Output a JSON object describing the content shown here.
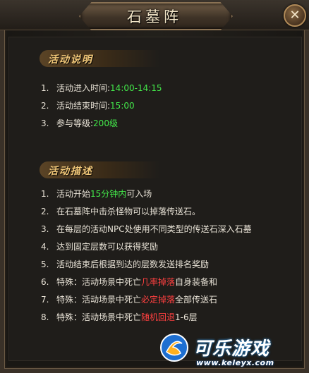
{
  "window": {
    "title": "石墓阵"
  },
  "sections": {
    "info": {
      "title": "活动说明",
      "items": [
        {
          "num": "1.",
          "label": "活动进入时间:",
          "value": "14:00-14:15"
        },
        {
          "num": "2.",
          "label": "活动结束时间:",
          "value": "15:00"
        },
        {
          "num": "3.",
          "label": "参与等级:",
          "value": "200级"
        }
      ]
    },
    "desc": {
      "title": "活动描述",
      "items": [
        {
          "num": "1.",
          "pre": "活动开始",
          "hl": "15分钟内",
          "post": "可入场"
        },
        {
          "num": "2.",
          "text": "在石墓阵中击杀怪物可以掉落传送石。"
        },
        {
          "num": "3.",
          "text": "在每层的活动NPC处使用不同类型的传送石深入石墓"
        },
        {
          "num": "4.",
          "text": "达到固定层数可以获得奖励"
        },
        {
          "num": "5.",
          "text": "活动结束后根据到达的层数发送排名奖励"
        },
        {
          "num": "6.",
          "pre": "特殊：活动场景中死亡",
          "hl": "几率掉落",
          "post": "自身装备和"
        },
        {
          "num": "7.",
          "pre": "特殊：活动场景中死亡",
          "hl": "必定掉落",
          "post": "全部传送石"
        },
        {
          "num": "8.",
          "pre": "特殊：活动场景中死亡",
          "hl": "随机回退",
          "post": "1-6层"
        }
      ]
    }
  },
  "watermark": {
    "name": "可乐游戏",
    "url": "www.keleyx.com"
  },
  "colors": {
    "highlight_green": "#43e84a",
    "special_blue": "#4aa6ff",
    "special_red": "#ff4040",
    "section_title": "#f2c879"
  },
  "icons": {
    "close": "close-icon",
    "logo": "keleyx-logo-icon"
  }
}
